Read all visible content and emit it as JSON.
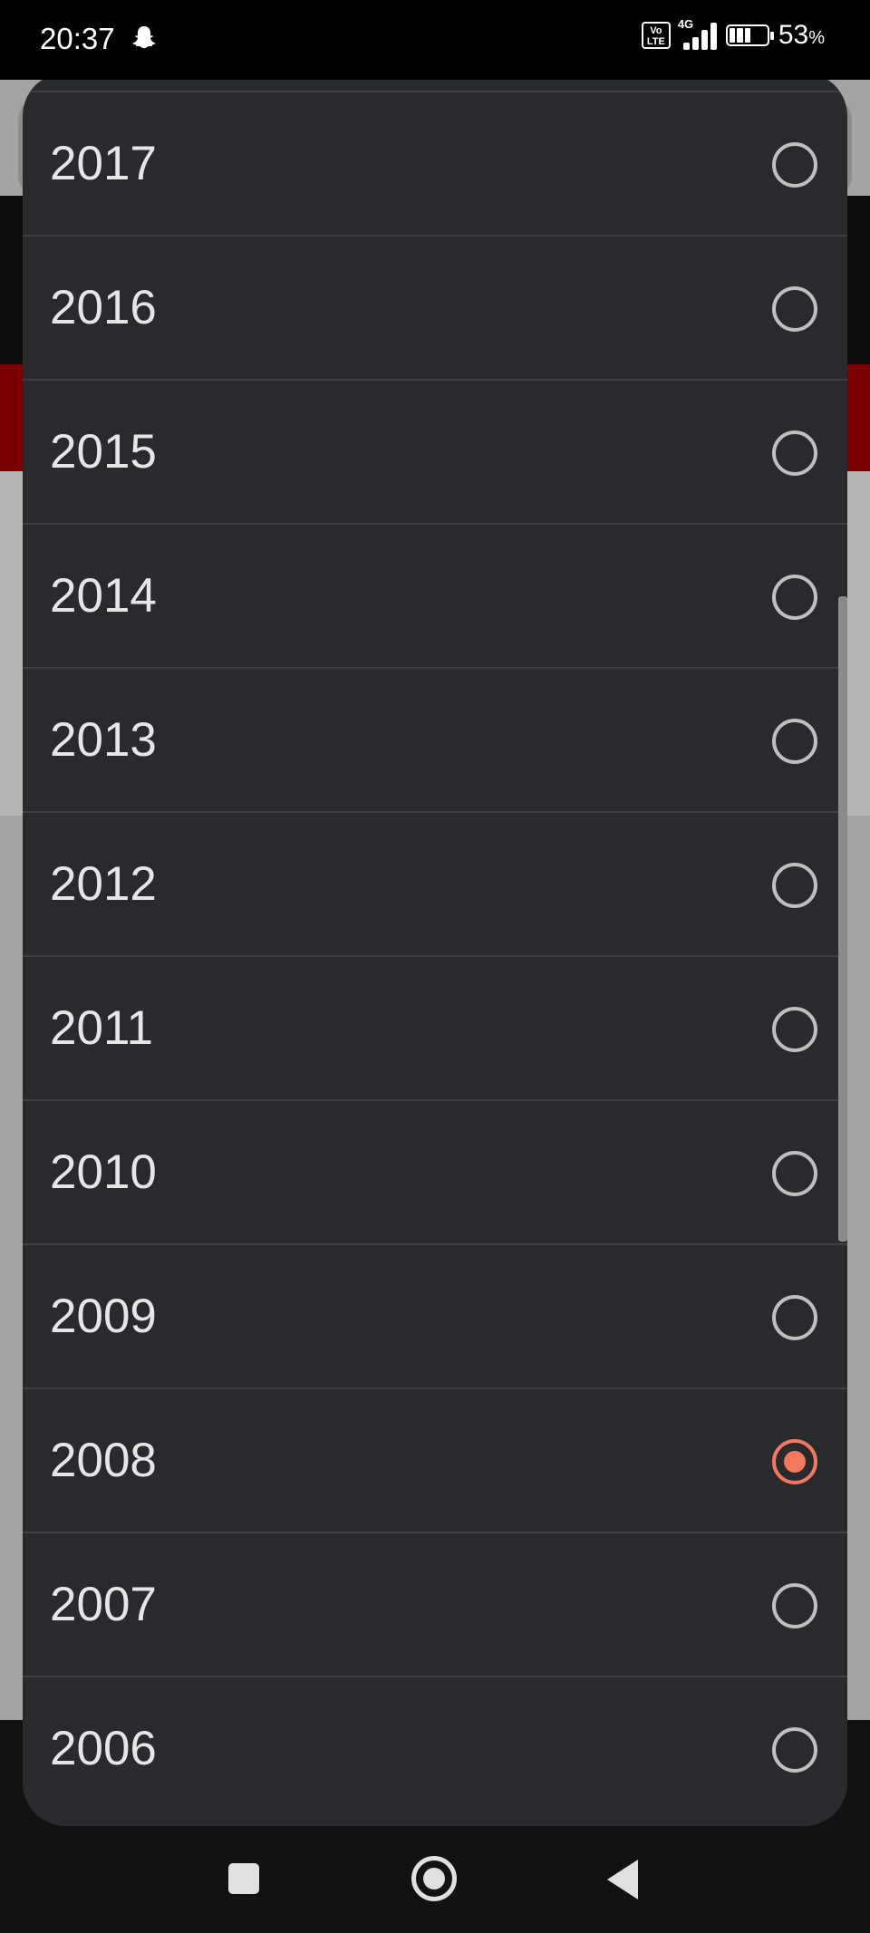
{
  "status_bar": {
    "time": "20:37",
    "volte_label": "Vo LTE",
    "network": "4G",
    "battery_percent": "53",
    "percent_sign": "%"
  },
  "year_picker": {
    "selected": "2008",
    "accent_color": "#f4785d",
    "items": [
      {
        "label": "2017",
        "checked": false
      },
      {
        "label": "2016",
        "checked": false
      },
      {
        "label": "2015",
        "checked": false
      },
      {
        "label": "2014",
        "checked": false
      },
      {
        "label": "2013",
        "checked": false
      },
      {
        "label": "2012",
        "checked": false
      },
      {
        "label": "2011",
        "checked": false
      },
      {
        "label": "2010",
        "checked": false
      },
      {
        "label": "2009",
        "checked": false
      },
      {
        "label": "2008",
        "checked": true
      },
      {
        "label": "2007",
        "checked": false
      },
      {
        "label": "2006",
        "checked": false
      }
    ]
  },
  "icons": {
    "status": [
      "snapchat-icon",
      "volte-icon",
      "signal-icon",
      "battery-icon"
    ],
    "navigation": [
      "recents-square-icon",
      "home-circle-icon",
      "back-triangle-icon"
    ]
  }
}
